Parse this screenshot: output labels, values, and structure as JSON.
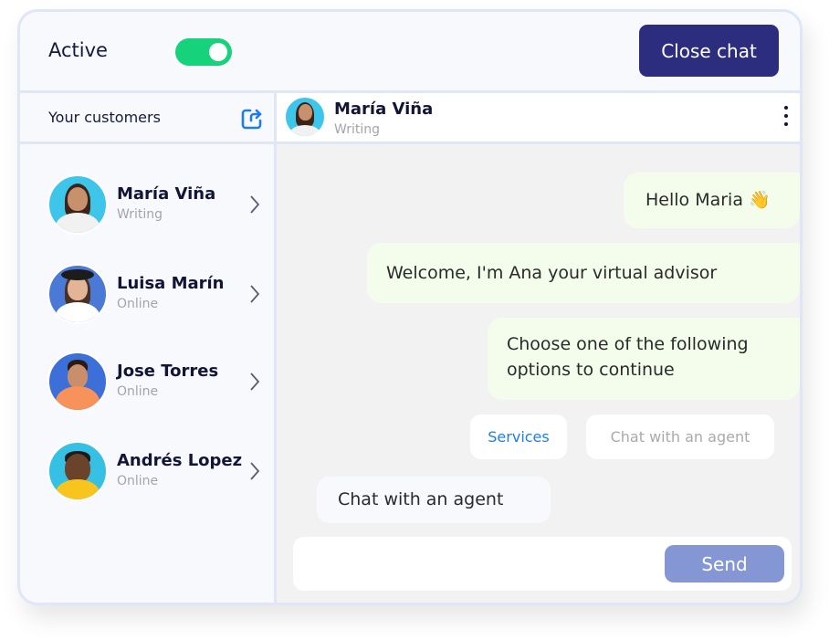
{
  "topbar": {
    "status_label": "Active",
    "status_toggle_on": true,
    "close_button": "Close chat"
  },
  "sidebar": {
    "title": "Your customers",
    "title_icon": "share-icon",
    "customers": [
      {
        "name": "María Viña",
        "status": "Writing",
        "avatar_bg": "#3ec6ea"
      },
      {
        "name": "Luisa Marín",
        "status": "Online",
        "avatar_bg": "#4b79d6"
      },
      {
        "name": "Jose Torres",
        "status": "Online",
        "avatar_bg": "#3c6fd8"
      },
      {
        "name": "Andrés Lopez",
        "status": "Online",
        "avatar_bg": "#36c1e4"
      }
    ]
  },
  "chat": {
    "contact_name": "María Viña",
    "contact_status": "Writing",
    "menu_icon": "kebab-menu-icon",
    "messages": [
      {
        "from": "bot",
        "text": "Hello Maria 👋"
      },
      {
        "from": "bot",
        "text": "Welcome, I'm Ana your virtual advisor"
      },
      {
        "from": "bot",
        "text": "Choose one of the following options to continue"
      }
    ],
    "options": [
      "Services",
      "Chat with an agent"
    ],
    "user_reply": "Chat with an agent",
    "compose_value": "",
    "send_button": "Send"
  },
  "colors": {
    "accent_dark": "#2d2d80",
    "toggle_on": "#16d27a",
    "link_blue": "#1f7de8",
    "send_button": "#8596d4",
    "bot_bubble": "#f4fdec"
  }
}
